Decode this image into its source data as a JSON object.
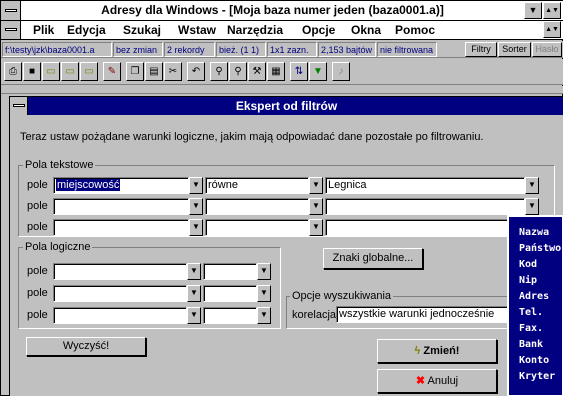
{
  "app": {
    "title": "Adresy dla Windows - [Moja baza numer jeden (baza0001.a)]",
    "minimize_glyph": "▼",
    "restore_glyph": "▲▼"
  },
  "menu": [
    "Plik",
    "Edycja",
    "Szukaj",
    "Wstaw",
    "Narzędzia",
    "Opcje",
    "Okna",
    "Pomoc"
  ],
  "status": {
    "path": "f:\\testy\\jzk\\baza0001.a",
    "changes": "bez zmian",
    "records": "2 rekordy",
    "current": "bież. (1 1)",
    "fields": "1x1 zazn.",
    "size": "2,153 bajtów",
    "filter": "nie filtrowana",
    "btn_filters": "Filtry",
    "btn_sorter": "Sorter",
    "btn_password": "Hasło"
  },
  "toolbar_icons": [
    "print-icon",
    "save-icon",
    "open-folder-icon",
    "new-folder-icon",
    "find-folder-icon",
    "edit-icon",
    "copy-icon",
    "paste-icon",
    "cut-icon",
    "undo-icon",
    "search-icon",
    "search-replace-icon",
    "tools-icon",
    "calendar-icon",
    "sort-icon",
    "filter-icon",
    "sound-icon"
  ],
  "dialog": {
    "title": "Ekspert od filtrów",
    "instruction": "Teraz ustaw pożądane warunki logiczne, jakim mają odpowiadać dane pozostałe po filtrowaniu.",
    "text_group_label": "Pola tekstowe",
    "field_label": "pole",
    "text_rows": [
      {
        "field": "miejscowość",
        "op": "równe",
        "value": "Legnica"
      },
      {
        "field": "",
        "op": "",
        "value": ""
      },
      {
        "field": "",
        "op": "",
        "value": ""
      }
    ],
    "logic_group_label": "Pola logiczne",
    "logic_rows": [
      {
        "field": "",
        "value": ""
      },
      {
        "field": "",
        "value": ""
      },
      {
        "field": "",
        "value": ""
      }
    ],
    "global_chars_button": "Znaki globalne...",
    "search_options_label": "Opcje wyszukiwania",
    "correlation_label": "korelacja",
    "correlation_value": "wszystkie warunki jednocześnie",
    "clear_button": "Wyczyść!",
    "change_button": "Zmień!",
    "cancel_button": "Anuluj"
  },
  "field_panel": [
    "Nazwa",
    "Państwo",
    "Kod",
    "Nip",
    "Adres",
    "Tel.",
    "Fax.",
    "Bank",
    "Konto",
    "Kryter"
  ],
  "colors": {
    "title_bar_active": "#000080",
    "face": "#c0c0c0",
    "selection": "#000080",
    "panel_bg": "#000080",
    "cancel_x": "#ff0000",
    "lightning": "#ffff00"
  }
}
